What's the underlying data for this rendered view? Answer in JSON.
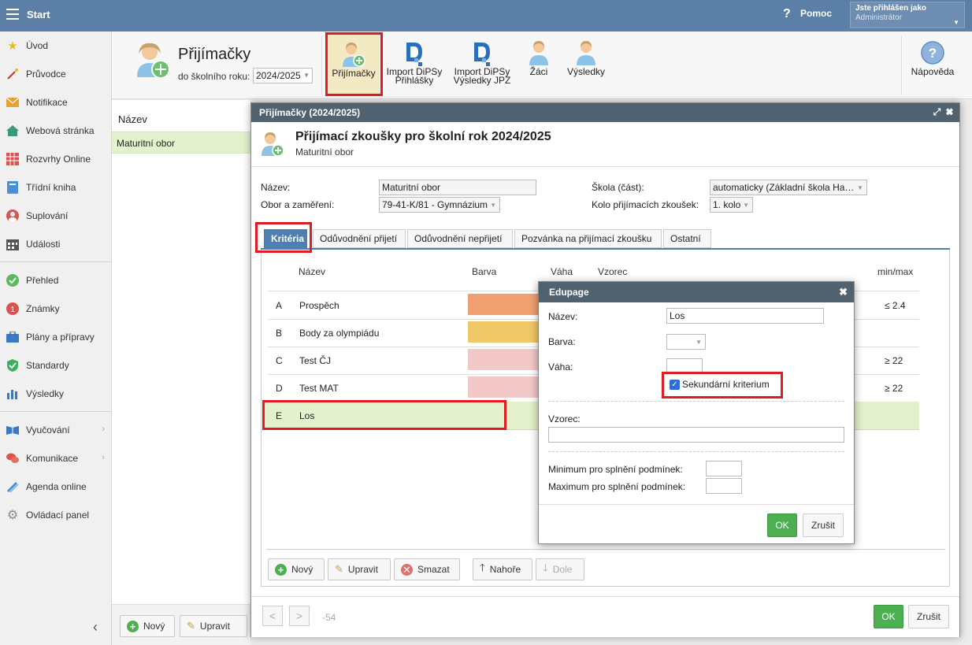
{
  "topbar": {
    "title": "Start",
    "help_label": "Pomoc",
    "help_glyph": "?",
    "user_line1": "Jste přihlášen jako",
    "user_line2": "Administrátor"
  },
  "sidebar": {
    "items": [
      {
        "label": "Úvod",
        "icon": "star-icon"
      },
      {
        "label": "Průvodce",
        "icon": "wand-icon"
      },
      {
        "label": "Notifikace",
        "icon": "envelope-icon"
      },
      {
        "label": "Webová stránka",
        "icon": "house-icon"
      },
      {
        "label": "Rozvrhy Online",
        "icon": "grid-icon"
      },
      {
        "label": "Třídní kniha",
        "icon": "book-icon"
      },
      {
        "label": "Suplování",
        "icon": "person-icon"
      },
      {
        "label": "Události",
        "icon": "calendar-icon"
      },
      {
        "label": "Přehled",
        "icon": "check-circle-icon"
      },
      {
        "label": "Známky",
        "icon": "grade-icon"
      },
      {
        "label": "Plány a přípravy",
        "icon": "briefcase-icon"
      },
      {
        "label": "Standardy",
        "icon": "shield-icon"
      },
      {
        "label": "Výsledky",
        "icon": "bar-chart-icon"
      },
      {
        "label": "Vyučování",
        "icon": "open-book-icon"
      },
      {
        "label": "Komunikace",
        "icon": "chat-icon"
      },
      {
        "label": "Agenda online",
        "icon": "pencil-icon"
      },
      {
        "label": "Ovládací panel",
        "icon": "gear-icon"
      }
    ],
    "collapse_glyph": "‹"
  },
  "toolbar": {
    "title": "Přijímačky",
    "year_label": "do školního roku:",
    "year_value": "2024/2025",
    "buttons": [
      {
        "label": "Přijímačky"
      },
      {
        "label1": "Import DiPSy",
        "label2": "Přihlášky"
      },
      {
        "label1": "Import DiPSy",
        "label2": "Výsledky JPZ"
      },
      {
        "label": "Žáci"
      },
      {
        "label": "Výsledky"
      }
    ],
    "help_label": "Nápověda",
    "help_glyph": "?"
  },
  "leftpanel": {
    "header": "Název",
    "row": "Maturitní obor"
  },
  "bottombar": {
    "new_label": "Nový",
    "edit_label": "Upravit"
  },
  "dialog": {
    "header": "Přijímačky (2024/2025)",
    "title": "Přijímací zkoušky pro školní rok 2024/2025",
    "subtitle": "Maturitní obor",
    "fields": {
      "name_label": "Název:",
      "name_value": "Maturitní obor",
      "obor_label": "Obor a zaměření:",
      "obor_value": "79-41-K/81 - Gymnázium",
      "school_label": "Škola (část):",
      "school_value": "automaticky (Základní škola Ha…",
      "round_label": "Kolo přijímacích zkoušek:",
      "round_value": "1. kolo"
    },
    "tabs": [
      "Kritéria",
      "Odůvodnění přijetí",
      "Odůvodnění nepřijetí",
      "Pozvánka na přijímací zkoušku",
      "Ostatní"
    ],
    "columns": {
      "name": "Název",
      "color": "Barva",
      "weight": "Váha",
      "formula": "Vzorec",
      "minmax": "min/max"
    },
    "criteria": [
      {
        "letter": "A",
        "name": "Prospěch",
        "color": "#f0a070",
        "minmax": "≤ 2.4"
      },
      {
        "letter": "B",
        "name": "Body za olympiádu",
        "color": "#f0c868",
        "minmax": ""
      },
      {
        "letter": "C",
        "name": "Test ČJ",
        "color": "#f2c8c8",
        "minmax": "≥ 22"
      },
      {
        "letter": "D",
        "name": "Test MAT",
        "color": "#f2c8c8",
        "minmax": "≥ 22"
      },
      {
        "letter": "E",
        "name": "Los",
        "color": "",
        "minmax": ""
      }
    ],
    "actions": {
      "new": "Nový",
      "edit": "Upravit",
      "delete": "Smazat",
      "up": "Nahoře",
      "down": "Dole"
    },
    "footer": {
      "prev": "<",
      "next": ">",
      "id": "-54",
      "ok": "OK",
      "cancel": "Zrušit"
    }
  },
  "popup": {
    "header": "Edupage",
    "name_label": "Název:",
    "name_value": "Los",
    "color_label": "Barva:",
    "weight_label": "Váha:",
    "secondary_label": "Sekundární kriterium",
    "formula_label": "Vzorec:",
    "min_label": "Minimum pro splnění podmínek:",
    "max_label": "Maximum pro splnění podmínek:",
    "ok": "OK",
    "cancel": "Zrušit"
  },
  "colors": {
    "topbar": "#5b7fa6",
    "accent_tab": "#4d7fb2",
    "selected_row": "#e3f1cc",
    "ok_green": "#4caf50",
    "highlight_red": "#e01b24"
  }
}
